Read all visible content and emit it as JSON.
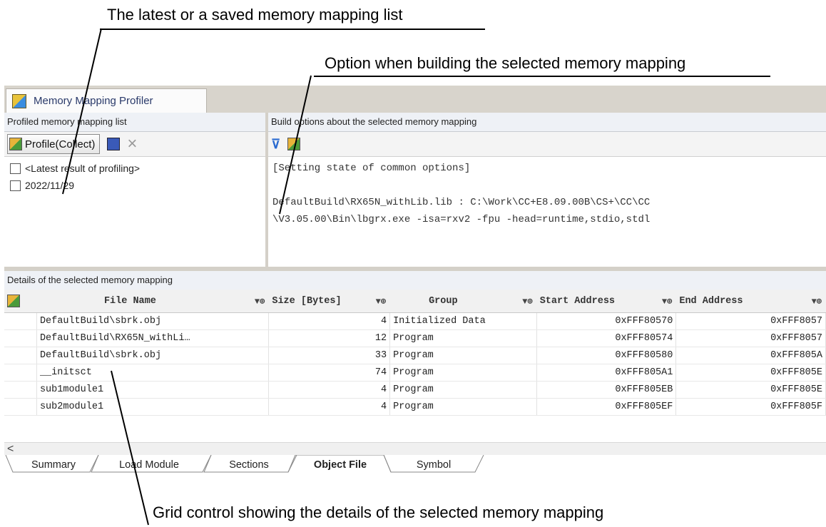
{
  "callouts": {
    "mapping_list": "The latest or a saved memory mapping list",
    "build_option": "Option when building the selected memory mapping",
    "grid": "Grid control showing the details of the selected memory mapping"
  },
  "window": {
    "tab_title": "Memory Mapping Profiler",
    "tab_icon": "profiler-icon"
  },
  "list_pane": {
    "header": "Profiled memory mapping list",
    "profile_button": "Profile(Collect)",
    "items": [
      {
        "label": "<Latest result of profiling>",
        "checked": false
      },
      {
        "label": "2022/11/29",
        "checked": false
      }
    ]
  },
  "options_pane": {
    "header": "Build options about the selected memory mapping",
    "lines": [
      "[Setting state of common options]",
      "",
      "DefaultBuild\\RX65N_withLib.lib : C:\\Work\\CC+E8.09.00B\\CS+\\CC\\CC",
      "\\V3.05.00\\Bin\\lbgrx.exe -isa=rxv2 -fpu -head=runtime,stdio,stdl"
    ]
  },
  "details": {
    "header": "Details of the selected memory mapping",
    "columns": [
      "File Name",
      "Size [Bytes]",
      "Group",
      "Start Address",
      "End Address"
    ],
    "rows": [
      [
        "DefaultBuild\\sbrk.obj",
        "4",
        "Initialized Data",
        "0xFFF80570",
        "0xFFF8057"
      ],
      [
        "DefaultBuild\\RX65N_withLi…",
        "12",
        "Program",
        "0xFFF80574",
        "0xFFF8057"
      ],
      [
        "DefaultBuild\\sbrk.obj",
        "33",
        "Program",
        "0xFFF80580",
        "0xFFF805A"
      ],
      [
        "__initsct",
        "74",
        "Program",
        "0xFFF805A1",
        "0xFFF805E"
      ],
      [
        "sub1module1",
        "4",
        "Program",
        "0xFFF805EB",
        "0xFFF805E"
      ],
      [
        "sub2module1",
        "4",
        "Program",
        "0xFFF805EF",
        "0xFFF805F"
      ]
    ]
  },
  "bottom_tabs": [
    "Summary",
    "Load Module",
    "Sections",
    "Object File",
    "Symbol"
  ],
  "active_tab": "Object File",
  "scroll_left_glyph": "<",
  "icons": {
    "filter_pin": "▼⊕",
    "filter": "filter-icon",
    "save": "save-icon",
    "delete": "×"
  }
}
